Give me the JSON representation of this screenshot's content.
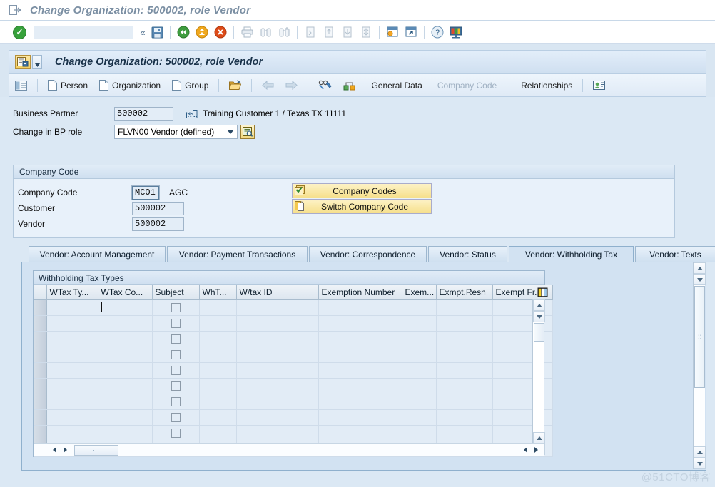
{
  "window": {
    "title": "Change Organization: 500002, role Vendor",
    "icon": "exit-arrow-icon"
  },
  "system_toolbar": {
    "ok_icon": "green-check-icon",
    "command_value": "",
    "command_placeholder": "",
    "expand_icon": "double-chevron-left-icon",
    "buttons": [
      {
        "name": "save-button",
        "icon": "floppy-disk-icon"
      },
      {
        "name": "back-button",
        "icon": "green-back-arrow-icon"
      },
      {
        "name": "exit-button",
        "icon": "yellow-up-arrow-icon"
      },
      {
        "name": "cancel-button",
        "icon": "red-x-icon"
      },
      {
        "name": "print-button",
        "icon": "printer-icon"
      },
      {
        "name": "find-button",
        "icon": "binoculars-icon"
      },
      {
        "name": "find-next-button",
        "icon": "binoculars-plus-icon"
      },
      {
        "name": "first-page-button",
        "icon": "first-page-icon"
      },
      {
        "name": "previous-page-button",
        "icon": "previous-page-icon"
      },
      {
        "name": "next-page-button",
        "icon": "next-page-icon"
      },
      {
        "name": "last-page-button",
        "icon": "last-page-icon"
      },
      {
        "name": "create-session-button",
        "icon": "new-session-icon"
      },
      {
        "name": "create-shortcut-button",
        "icon": "shortcut-icon"
      },
      {
        "name": "help-button",
        "icon": "question-mark-icon"
      },
      {
        "name": "customize-layout-button",
        "icon": "monitor-icon"
      }
    ]
  },
  "app_header": {
    "title": "Change Organization: 500002, role Vendor",
    "icon": "bp-maintain-icon",
    "menu_arrow": "dropdown-arrow-icon"
  },
  "app_toolbar": {
    "items": [
      {
        "name": "overview-button",
        "label": "",
        "icon": "list-overview-icon",
        "disabled": false
      },
      {
        "name": "person-button",
        "label": "Person",
        "icon": "document-icon",
        "disabled": false
      },
      {
        "name": "organization-button",
        "label": "Organization",
        "icon": "document-icon",
        "disabled": false
      },
      {
        "name": "group-button",
        "label": "Group",
        "icon": "document-icon",
        "disabled": false
      },
      {
        "name": "open-button",
        "label": "",
        "icon": "open-folder-icon",
        "disabled": false
      },
      {
        "name": "back-nav-button",
        "label": "",
        "icon": "left-arrow-icon",
        "disabled": true
      },
      {
        "name": "forward-nav-button",
        "label": "",
        "icon": "right-arrow-icon",
        "disabled": true
      },
      {
        "name": "display-change-button",
        "label": "",
        "icon": "glasses-pencil-icon",
        "disabled": false
      },
      {
        "name": "relationship-icon-button",
        "label": "",
        "icon": "org-node-icon",
        "disabled": false
      },
      {
        "name": "general-data-button",
        "label": "General Data",
        "icon": "",
        "disabled": false
      },
      {
        "name": "company-code-button",
        "label": "Company Code",
        "icon": "",
        "disabled": true
      },
      {
        "name": "relationships-button",
        "label": "Relationships",
        "icon": "",
        "disabled": false
      },
      {
        "name": "business-partner-role-button",
        "label": "",
        "icon": "person-card-icon",
        "disabled": false
      }
    ]
  },
  "business_partner": {
    "label": "Business Partner",
    "value": "500002",
    "description_icon": "factory-icon",
    "description": "Training Customer 1 / Texas TX 11111",
    "role_label": "Change in BP role",
    "role_value": "FLVN00 Vendor (defined)",
    "role_options": [
      "FLVN00 Vendor (defined)"
    ],
    "role_search_icon": "search-help-icon"
  },
  "company_code_group": {
    "title": "Company Code",
    "rows": [
      {
        "label": "Company Code",
        "value": "MCO1",
        "selected": true,
        "suffix": "AGC"
      },
      {
        "label": "Customer",
        "value": "500002",
        "selected": false,
        "suffix": ""
      },
      {
        "label": "Vendor",
        "value": "500002",
        "selected": false,
        "suffix": ""
      }
    ],
    "buttons": [
      {
        "name": "company-codes-button",
        "label": "Company Codes",
        "icon": "checked-list-icon"
      },
      {
        "name": "switch-company-code-button",
        "label": "Switch Company Code",
        "icon": "switch-icon"
      }
    ]
  },
  "tabs": [
    {
      "name": "tab-vendor-account-management",
      "label": "Vendor: Account Management",
      "active": false
    },
    {
      "name": "tab-vendor-payment-transactions",
      "label": "Vendor: Payment Transactions",
      "active": false
    },
    {
      "name": "tab-vendor-correspondence",
      "label": "Vendor: Correspondence",
      "active": false
    },
    {
      "name": "tab-vendor-status",
      "label": "Vendor: Status",
      "active": false
    },
    {
      "name": "tab-vendor-withholding-tax",
      "label": "Vendor: Withholding Tax",
      "active": true
    },
    {
      "name": "tab-vendor-texts",
      "label": "Vendor: Texts",
      "active": false
    }
  ],
  "withholding_table": {
    "title": "Withholding Tax Types",
    "columns": [
      "WTax Ty...",
      "WTax Co...",
      "Subject",
      "WhT...",
      "W/tax ID",
      "Exemption Number",
      "Exem...",
      "Exmpt.Resn",
      "Exempt Fr."
    ],
    "config_icon": "table-settings-icon",
    "row_count": 10,
    "rows": [
      {
        "wtax_type": "",
        "wtax_code": "",
        "subject": false,
        "wht": "",
        "wtax_id": "",
        "exemption_number": "",
        "exem": "",
        "exmpt_resn": "",
        "exempt_fr": "",
        "focused": true
      },
      {
        "wtax_type": "",
        "wtax_code": "",
        "subject": false,
        "wht": "",
        "wtax_id": "",
        "exemption_number": "",
        "exem": "",
        "exmpt_resn": "",
        "exempt_fr": "",
        "focused": false
      },
      {
        "wtax_type": "",
        "wtax_code": "",
        "subject": false,
        "wht": "",
        "wtax_id": "",
        "exemption_number": "",
        "exem": "",
        "exmpt_resn": "",
        "exempt_fr": "",
        "focused": false
      },
      {
        "wtax_type": "",
        "wtax_code": "",
        "subject": false,
        "wht": "",
        "wtax_id": "",
        "exemption_number": "",
        "exem": "",
        "exmpt_resn": "",
        "exempt_fr": "",
        "focused": false
      },
      {
        "wtax_type": "",
        "wtax_code": "",
        "subject": false,
        "wht": "",
        "wtax_id": "",
        "exemption_number": "",
        "exem": "",
        "exmpt_resn": "",
        "exempt_fr": "",
        "focused": false
      },
      {
        "wtax_type": "",
        "wtax_code": "",
        "subject": false,
        "wht": "",
        "wtax_id": "",
        "exemption_number": "",
        "exem": "",
        "exmpt_resn": "",
        "exempt_fr": "",
        "focused": false
      },
      {
        "wtax_type": "",
        "wtax_code": "",
        "subject": false,
        "wht": "",
        "wtax_id": "",
        "exemption_number": "",
        "exem": "",
        "exmpt_resn": "",
        "exempt_fr": "",
        "focused": false
      },
      {
        "wtax_type": "",
        "wtax_code": "",
        "subject": false,
        "wht": "",
        "wtax_id": "",
        "exemption_number": "",
        "exem": "",
        "exmpt_resn": "",
        "exempt_fr": "",
        "focused": false
      },
      {
        "wtax_type": "",
        "wtax_code": "",
        "subject": false,
        "wht": "",
        "wtax_id": "",
        "exemption_number": "",
        "exem": "",
        "exmpt_resn": "",
        "exempt_fr": "",
        "focused": false
      },
      {
        "wtax_type": "",
        "wtax_code": "",
        "subject": false,
        "wht": "",
        "wtax_id": "",
        "exemption_number": "",
        "exem": "",
        "exmpt_resn": "",
        "exempt_fr": "",
        "focused": false
      }
    ]
  },
  "watermark": "@51CTO博客",
  "colors": {
    "background": "#dbe8f4",
    "panel": "#d2e2f2",
    "button_yellow": "#f6e08c",
    "title_text": "#7b8fa3",
    "accent_blue": "#8fb0cd"
  }
}
